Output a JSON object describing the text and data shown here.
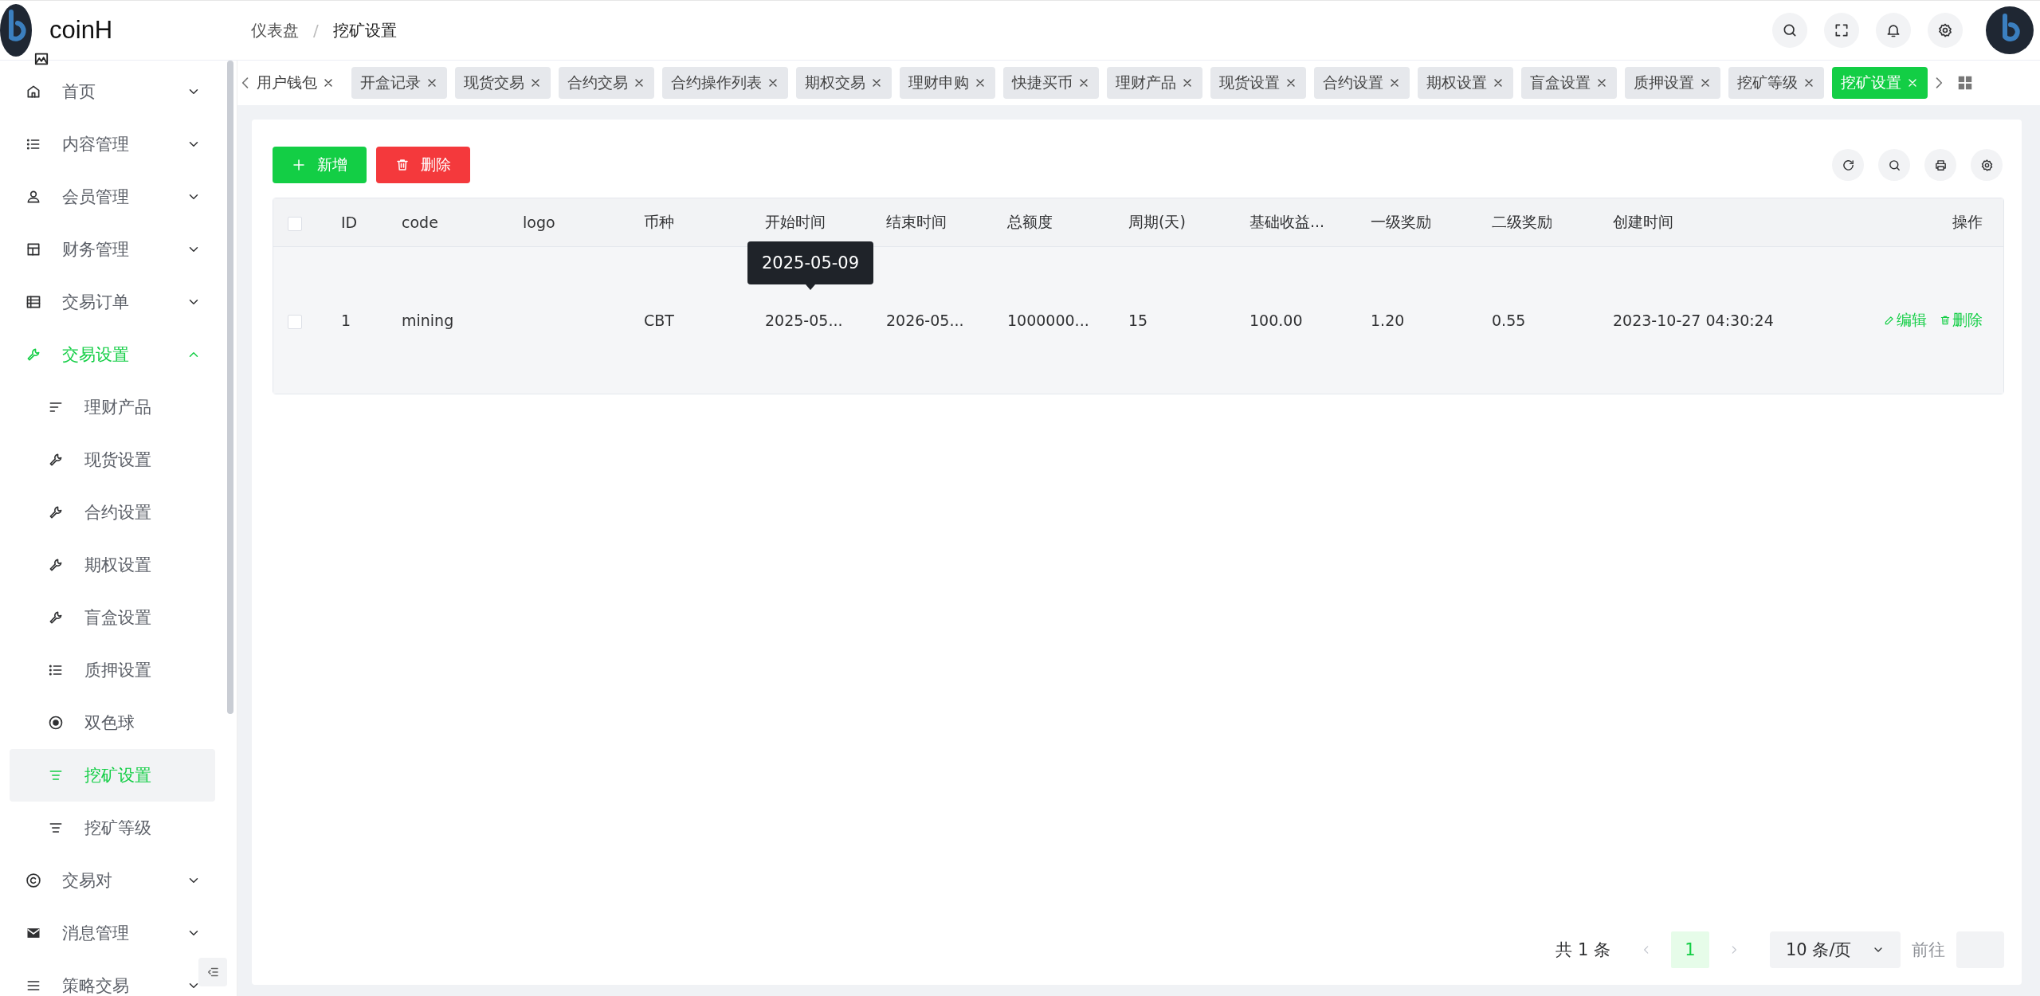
{
  "logo": {
    "name": "coinH"
  },
  "breadcrumb": {
    "items": [
      "仪表盘",
      "挖矿设置"
    ],
    "separator": "/"
  },
  "sidebar": {
    "items": [
      {
        "label": "首页",
        "expanded": false
      },
      {
        "label": "内容管理",
        "expanded": false
      },
      {
        "label": "会员管理",
        "expanded": false
      },
      {
        "label": "财务管理",
        "expanded": false
      },
      {
        "label": "交易订单",
        "expanded": false
      },
      {
        "label": "交易设置",
        "expanded": true,
        "children": [
          {
            "label": "理财产品",
            "selected": false
          },
          {
            "label": "现货设置",
            "selected": false
          },
          {
            "label": "合约设置",
            "selected": false
          },
          {
            "label": "期权设置",
            "selected": false
          },
          {
            "label": "盲盒设置",
            "selected": false
          },
          {
            "label": "质押设置",
            "selected": false
          },
          {
            "label": "双色球",
            "selected": false
          },
          {
            "label": "挖矿设置",
            "selected": true
          },
          {
            "label": "挖矿等级",
            "selected": false
          }
        ]
      },
      {
        "label": "交易对",
        "expanded": false
      },
      {
        "label": "消息管理",
        "expanded": false
      },
      {
        "label": "策略交易",
        "expanded": false
      }
    ]
  },
  "tabs": [
    {
      "label": "用户钱包",
      "selected": false
    },
    {
      "label": "开盒记录",
      "selected": false
    },
    {
      "label": "现货交易",
      "selected": false
    },
    {
      "label": "合约交易",
      "selected": false
    },
    {
      "label": "合约操作列表",
      "selected": false
    },
    {
      "label": "期权交易",
      "selected": false
    },
    {
      "label": "理财申购",
      "selected": false
    },
    {
      "label": "快捷买币",
      "selected": false
    },
    {
      "label": "理财产品",
      "selected": false
    },
    {
      "label": "现货设置",
      "selected": false
    },
    {
      "label": "合约设置",
      "selected": false
    },
    {
      "label": "期权设置",
      "selected": false
    },
    {
      "label": "盲盒设置",
      "selected": false
    },
    {
      "label": "质押设置",
      "selected": false
    },
    {
      "label": "挖矿等级",
      "selected": false
    },
    {
      "label": "挖矿设置",
      "selected": true
    }
  ],
  "toolbar": {
    "buttons": [
      {
        "label": "新增",
        "kind": "add"
      },
      {
        "label": "删除",
        "kind": "delete"
      }
    ]
  },
  "table": {
    "select_all": {
      "checked": false
    },
    "columns": [
      "ID",
      "code",
      "logo",
      "币种",
      "开始时间",
      "结束时间",
      "总额度",
      "周期(天)",
      "基础收益...",
      "一级奖励",
      "二级奖励",
      "创建时间",
      "操作"
    ],
    "rows": [
      {
        "checked": false,
        "cells": [
          "1",
          "mining",
          null,
          "CBT",
          "2025-05...",
          "2026-05...",
          "1000000...",
          "15",
          "100.00",
          "1.20",
          "0.55",
          "2023-10-27 04:30:24"
        ],
        "actions": [
          {
            "label": "编辑",
            "kind": "edit"
          },
          {
            "label": "删除",
            "kind": "delete"
          }
        ]
      }
    ],
    "tooltip": {
      "text": "2025-05-09"
    }
  },
  "pagination": {
    "total": "共 1 条",
    "pages": [
      {
        "label": "1",
        "selected": true
      }
    ],
    "page_size": "10 条/页",
    "goto": "前往"
  }
}
